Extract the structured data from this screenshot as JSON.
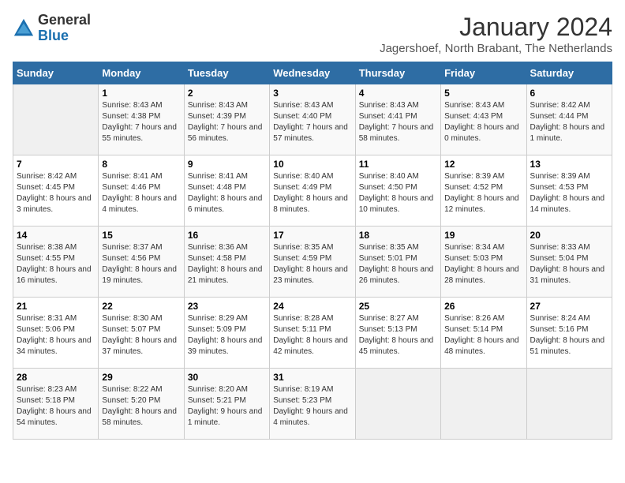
{
  "logo": {
    "general": "General",
    "blue": "Blue"
  },
  "title": "January 2024",
  "location": "Jagershoef, North Brabant, The Netherlands",
  "days_of_week": [
    "Sunday",
    "Monday",
    "Tuesday",
    "Wednesday",
    "Thursday",
    "Friday",
    "Saturday"
  ],
  "weeks": [
    [
      {
        "day": "",
        "sunrise": "",
        "sunset": "",
        "daylight": ""
      },
      {
        "day": "1",
        "sunrise": "Sunrise: 8:43 AM",
        "sunset": "Sunset: 4:38 PM",
        "daylight": "Daylight: 7 hours and 55 minutes."
      },
      {
        "day": "2",
        "sunrise": "Sunrise: 8:43 AM",
        "sunset": "Sunset: 4:39 PM",
        "daylight": "Daylight: 7 hours and 56 minutes."
      },
      {
        "day": "3",
        "sunrise": "Sunrise: 8:43 AM",
        "sunset": "Sunset: 4:40 PM",
        "daylight": "Daylight: 7 hours and 57 minutes."
      },
      {
        "day": "4",
        "sunrise": "Sunrise: 8:43 AM",
        "sunset": "Sunset: 4:41 PM",
        "daylight": "Daylight: 7 hours and 58 minutes."
      },
      {
        "day": "5",
        "sunrise": "Sunrise: 8:43 AM",
        "sunset": "Sunset: 4:43 PM",
        "daylight": "Daylight: 8 hours and 0 minutes."
      },
      {
        "day": "6",
        "sunrise": "Sunrise: 8:42 AM",
        "sunset": "Sunset: 4:44 PM",
        "daylight": "Daylight: 8 hours and 1 minute."
      }
    ],
    [
      {
        "day": "7",
        "sunrise": "Sunrise: 8:42 AM",
        "sunset": "Sunset: 4:45 PM",
        "daylight": "Daylight: 8 hours and 3 minutes."
      },
      {
        "day": "8",
        "sunrise": "Sunrise: 8:41 AM",
        "sunset": "Sunset: 4:46 PM",
        "daylight": "Daylight: 8 hours and 4 minutes."
      },
      {
        "day": "9",
        "sunrise": "Sunrise: 8:41 AM",
        "sunset": "Sunset: 4:48 PM",
        "daylight": "Daylight: 8 hours and 6 minutes."
      },
      {
        "day": "10",
        "sunrise": "Sunrise: 8:40 AM",
        "sunset": "Sunset: 4:49 PM",
        "daylight": "Daylight: 8 hours and 8 minutes."
      },
      {
        "day": "11",
        "sunrise": "Sunrise: 8:40 AM",
        "sunset": "Sunset: 4:50 PM",
        "daylight": "Daylight: 8 hours and 10 minutes."
      },
      {
        "day": "12",
        "sunrise": "Sunrise: 8:39 AM",
        "sunset": "Sunset: 4:52 PM",
        "daylight": "Daylight: 8 hours and 12 minutes."
      },
      {
        "day": "13",
        "sunrise": "Sunrise: 8:39 AM",
        "sunset": "Sunset: 4:53 PM",
        "daylight": "Daylight: 8 hours and 14 minutes."
      }
    ],
    [
      {
        "day": "14",
        "sunrise": "Sunrise: 8:38 AM",
        "sunset": "Sunset: 4:55 PM",
        "daylight": "Daylight: 8 hours and 16 minutes."
      },
      {
        "day": "15",
        "sunrise": "Sunrise: 8:37 AM",
        "sunset": "Sunset: 4:56 PM",
        "daylight": "Daylight: 8 hours and 19 minutes."
      },
      {
        "day": "16",
        "sunrise": "Sunrise: 8:36 AM",
        "sunset": "Sunset: 4:58 PM",
        "daylight": "Daylight: 8 hours and 21 minutes."
      },
      {
        "day": "17",
        "sunrise": "Sunrise: 8:35 AM",
        "sunset": "Sunset: 4:59 PM",
        "daylight": "Daylight: 8 hours and 23 minutes."
      },
      {
        "day": "18",
        "sunrise": "Sunrise: 8:35 AM",
        "sunset": "Sunset: 5:01 PM",
        "daylight": "Daylight: 8 hours and 26 minutes."
      },
      {
        "day": "19",
        "sunrise": "Sunrise: 8:34 AM",
        "sunset": "Sunset: 5:03 PM",
        "daylight": "Daylight: 8 hours and 28 minutes."
      },
      {
        "day": "20",
        "sunrise": "Sunrise: 8:33 AM",
        "sunset": "Sunset: 5:04 PM",
        "daylight": "Daylight: 8 hours and 31 minutes."
      }
    ],
    [
      {
        "day": "21",
        "sunrise": "Sunrise: 8:31 AM",
        "sunset": "Sunset: 5:06 PM",
        "daylight": "Daylight: 8 hours and 34 minutes."
      },
      {
        "day": "22",
        "sunrise": "Sunrise: 8:30 AM",
        "sunset": "Sunset: 5:07 PM",
        "daylight": "Daylight: 8 hours and 37 minutes."
      },
      {
        "day": "23",
        "sunrise": "Sunrise: 8:29 AM",
        "sunset": "Sunset: 5:09 PM",
        "daylight": "Daylight: 8 hours and 39 minutes."
      },
      {
        "day": "24",
        "sunrise": "Sunrise: 8:28 AM",
        "sunset": "Sunset: 5:11 PM",
        "daylight": "Daylight: 8 hours and 42 minutes."
      },
      {
        "day": "25",
        "sunrise": "Sunrise: 8:27 AM",
        "sunset": "Sunset: 5:13 PM",
        "daylight": "Daylight: 8 hours and 45 minutes."
      },
      {
        "day": "26",
        "sunrise": "Sunrise: 8:26 AM",
        "sunset": "Sunset: 5:14 PM",
        "daylight": "Daylight: 8 hours and 48 minutes."
      },
      {
        "day": "27",
        "sunrise": "Sunrise: 8:24 AM",
        "sunset": "Sunset: 5:16 PM",
        "daylight": "Daylight: 8 hours and 51 minutes."
      }
    ],
    [
      {
        "day": "28",
        "sunrise": "Sunrise: 8:23 AM",
        "sunset": "Sunset: 5:18 PM",
        "daylight": "Daylight: 8 hours and 54 minutes."
      },
      {
        "day": "29",
        "sunrise": "Sunrise: 8:22 AM",
        "sunset": "Sunset: 5:20 PM",
        "daylight": "Daylight: 8 hours and 58 minutes."
      },
      {
        "day": "30",
        "sunrise": "Sunrise: 8:20 AM",
        "sunset": "Sunset: 5:21 PM",
        "daylight": "Daylight: 9 hours and 1 minute."
      },
      {
        "day": "31",
        "sunrise": "Sunrise: 8:19 AM",
        "sunset": "Sunset: 5:23 PM",
        "daylight": "Daylight: 9 hours and 4 minutes."
      },
      {
        "day": "",
        "sunrise": "",
        "sunset": "",
        "daylight": ""
      },
      {
        "day": "",
        "sunrise": "",
        "sunset": "",
        "daylight": ""
      },
      {
        "day": "",
        "sunrise": "",
        "sunset": "",
        "daylight": ""
      }
    ]
  ]
}
